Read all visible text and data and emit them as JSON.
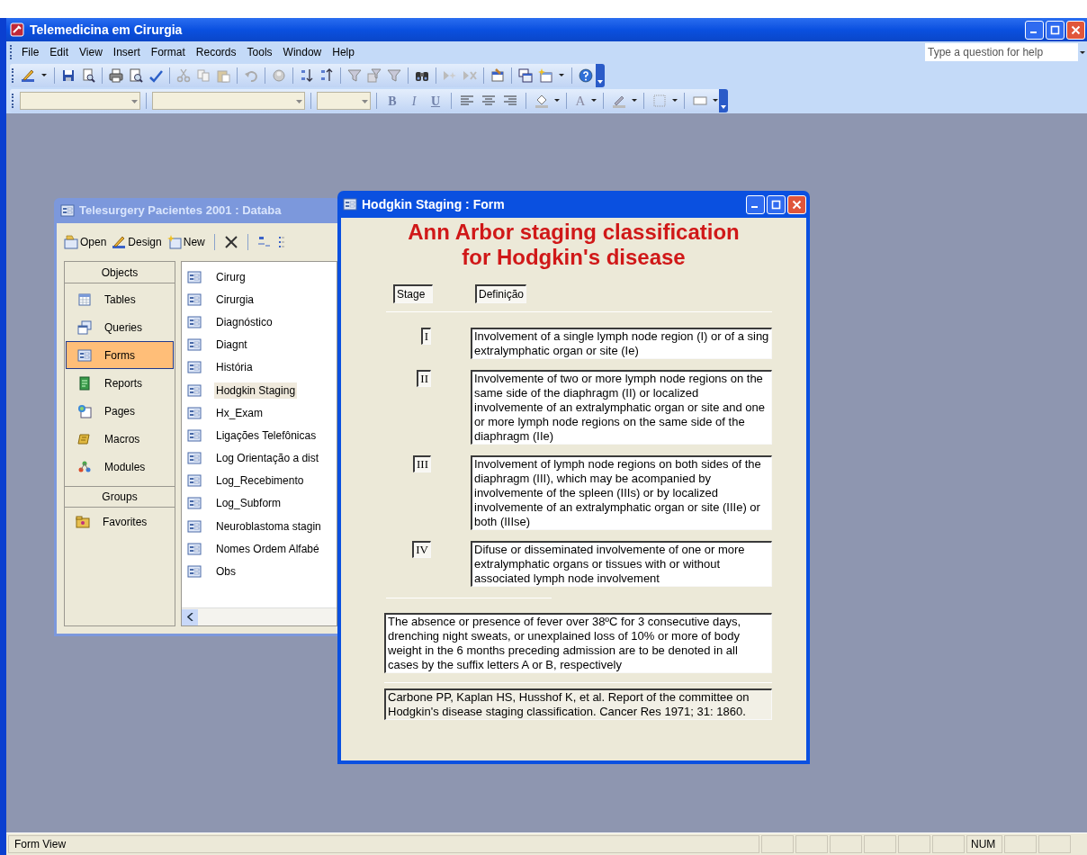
{
  "app": {
    "title": "Telemedicina em Cirurgia"
  },
  "menu": [
    "File",
    "Edit",
    "View",
    "Insert",
    "Format",
    "Records",
    "Tools",
    "Window",
    "Help"
  ],
  "help_box": {
    "placeholder": "Type a question for help"
  },
  "format_toolbar": {
    "buttons": [
      {
        "label": "B",
        "kind": "bold"
      },
      {
        "label": "I",
        "kind": "italic"
      },
      {
        "label": "U",
        "kind": "underline"
      }
    ],
    "font_color": "A"
  },
  "database_window": {
    "title": "Telesurgery Pacientes 2001 : Databa",
    "toolbar": [
      {
        "label": "Open",
        "kind": "open"
      },
      {
        "label": "Design",
        "kind": "design"
      },
      {
        "label": "New",
        "kind": "new"
      }
    ],
    "objects_header": "Objects",
    "objects": [
      {
        "label": "Tables",
        "kind": "table",
        "selected": false
      },
      {
        "label": "Queries",
        "kind": "query",
        "selected": false
      },
      {
        "label": "Forms",
        "kind": "form",
        "selected": true
      },
      {
        "label": "Reports",
        "kind": "report",
        "selected": false
      },
      {
        "label": "Pages",
        "kind": "page",
        "selected": false
      },
      {
        "label": "Macros",
        "kind": "macro",
        "selected": false
      },
      {
        "label": "Modules",
        "kind": "module",
        "selected": false
      }
    ],
    "groups_header": "Groups",
    "groups": [
      {
        "label": "Favorites"
      }
    ],
    "items": [
      {
        "label": "Cirurg",
        "selected": false
      },
      {
        "label": "Cirurgia",
        "selected": false
      },
      {
        "label": "Diagnóstico",
        "selected": false
      },
      {
        "label": "Diagnt",
        "selected": false
      },
      {
        "label": "História",
        "selected": false
      },
      {
        "label": "Hodgkin Staging",
        "selected": true
      },
      {
        "label": "Hx_Exam",
        "selected": false
      },
      {
        "label": "Ligações Telefônicas",
        "selected": false
      },
      {
        "label": "Log Orientação a dist",
        "selected": false
      },
      {
        "label": "Log_Recebimento",
        "selected": false
      },
      {
        "label": "Log_Subform",
        "selected": false
      },
      {
        "label": "Neuroblastoma stagin",
        "selected": false
      },
      {
        "label": "Nomes Ordem Alfabé",
        "selected": false
      },
      {
        "label": "Obs",
        "selected": false
      }
    ]
  },
  "form_window": {
    "title": "Hodgkin Staging : Form",
    "heading": [
      "Ann Arbor staging classification",
      "for Hodgkin's disease"
    ],
    "stage_header": "Stage",
    "definition_header": "Definição",
    "stages": [
      {
        "stage": "I",
        "definition": "Involvement of a single lymph node region (I) or of a sing extralymphatic organ or site (Ie)"
      },
      {
        "stage": "II",
        "definition": "Involvemente of two or more lymph node regions on the same side of the diaphragm (II) or localized involvemente of an extralymphatic organ or site and one or more lymph node regions on the same side of the diaphragm (IIe)"
      },
      {
        "stage": "III",
        "definition": "Involvement of lymph node regions on both sides of the diaphragm (III), which may be acompanied by involvemente of the spleen (IIIs) or by localized involvemente of an extralymphatic organ or site (IIIe) or both (IIIse)"
      },
      {
        "stage": "IV",
        "definition": "Difuse or disseminated involvemente of one or more extralymphatic organs or tissues with or without associated lymph node involvement"
      }
    ],
    "note": "The absence or presence of fever over 38ºC for 3 consecutive days, drenching night sweats, or unexplained loss of 10% or more of body weight in the 6 months preceding admission are to be denoted in all cases by the suffix letters A or B, respectively",
    "reference": "Carbone PP, Kaplan HS, Husshof K, et al. Report of the committee on Hodgkin's disease staging classification. Cancer Res 1971; 31: 1860."
  },
  "status_bar": {
    "text": "Form View",
    "indicators": [
      "NUM"
    ]
  }
}
